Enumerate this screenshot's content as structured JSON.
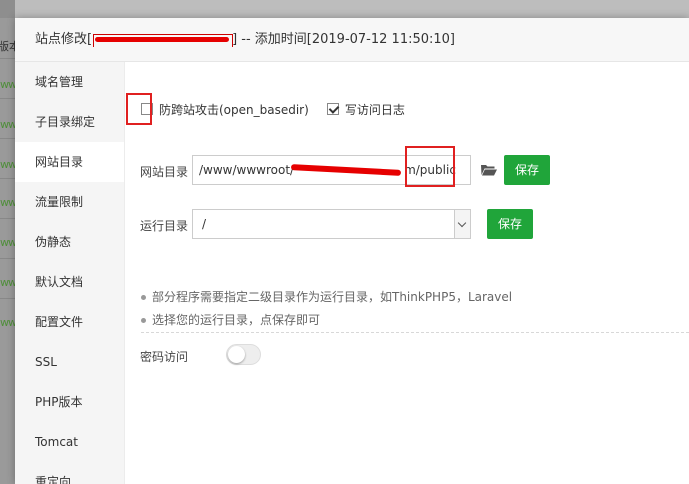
{
  "background": {
    "label": "版本"
  },
  "modal": {
    "title_prefix": "站点修改[",
    "title_suffix": "] -- 添加时间[2019-07-12 11:50:10]"
  },
  "sidebar": {
    "items": [
      {
        "label": "域名管理"
      },
      {
        "label": "子目录绑定"
      },
      {
        "label": "网站目录",
        "active": true
      },
      {
        "label": "流量限制"
      },
      {
        "label": "伪静态"
      },
      {
        "label": "默认文档"
      },
      {
        "label": "配置文件"
      },
      {
        "label": "SSL"
      },
      {
        "label": "PHP版本"
      },
      {
        "label": "Tomcat"
      },
      {
        "label": "重定向"
      }
    ]
  },
  "options": {
    "anti_xss_label": "防跨站攻击(open_basedir)",
    "anti_xss_checked": false,
    "access_log_label": "写访问日志",
    "access_log_checked": true
  },
  "site_dir": {
    "label": "网站目录",
    "value_start": "/www/wwwroot/",
    "value_end": "m/public",
    "save_label": "保存"
  },
  "run_dir": {
    "label": "运行目录",
    "value": "/",
    "save_label": "保存"
  },
  "tips": [
    "部分程序需要指定二级目录作为运行目录，如ThinkPHP5，Laravel",
    "选择您的运行目录，点保存即可"
  ],
  "password_access": {
    "label": "密码访问",
    "enabled": false
  },
  "colors": {
    "primary_green": "#20a53a",
    "highlight_red": "#e02020"
  }
}
